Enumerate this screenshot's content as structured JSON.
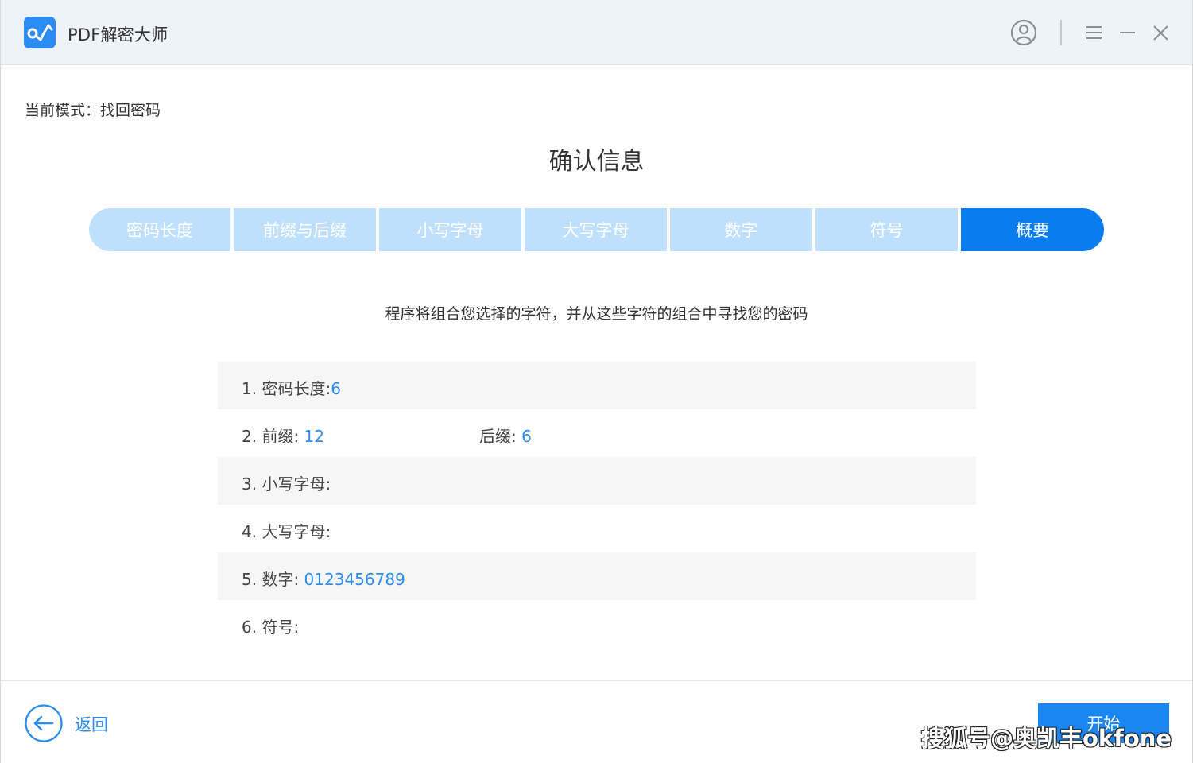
{
  "window": {
    "app_title": "PDF解密大师",
    "icons": [
      "app-logo-icon",
      "user-icon",
      "menu-icon",
      "minimize-icon",
      "close-icon"
    ]
  },
  "mode": {
    "text": "当前模式：找回密码"
  },
  "page_title": "确认信息",
  "steps": [
    {
      "label": "密码长度",
      "active": false
    },
    {
      "label": "前缀与后缀",
      "active": false
    },
    {
      "label": "小写字母",
      "active": false
    },
    {
      "label": "大写字母",
      "active": false
    },
    {
      "label": "数字",
      "active": false
    },
    {
      "label": "符号",
      "active": false
    },
    {
      "label": "概要",
      "active": true
    }
  ],
  "description": "程序将组合您选择的字符，并从这些字符的组合中寻找您的密码",
  "summary": {
    "row1": {
      "label": "1. 密码长度:",
      "value": "6"
    },
    "row2": {
      "label": "2. 前缀:",
      "value": "12",
      "label2": "后缀:",
      "value2": "6"
    },
    "row3": {
      "label": "3. 小写字母:",
      "value": ""
    },
    "row4": {
      "label": "4. 大写字母:",
      "value": ""
    },
    "row5": {
      "label": "5. 数字:",
      "value": "0123456789"
    },
    "row6": {
      "label": "6. 符号:",
      "value": ""
    }
  },
  "footer": {
    "back_label": "返回",
    "start_label": "开始"
  },
  "watermark": "搜狐号@奥凯丰okfone",
  "colors": {
    "accent": "#0a7cf0",
    "step_inactive": "#bfe0fc",
    "value_text": "#2b8cf3",
    "titlebar_bg": "#eef3f9"
  }
}
